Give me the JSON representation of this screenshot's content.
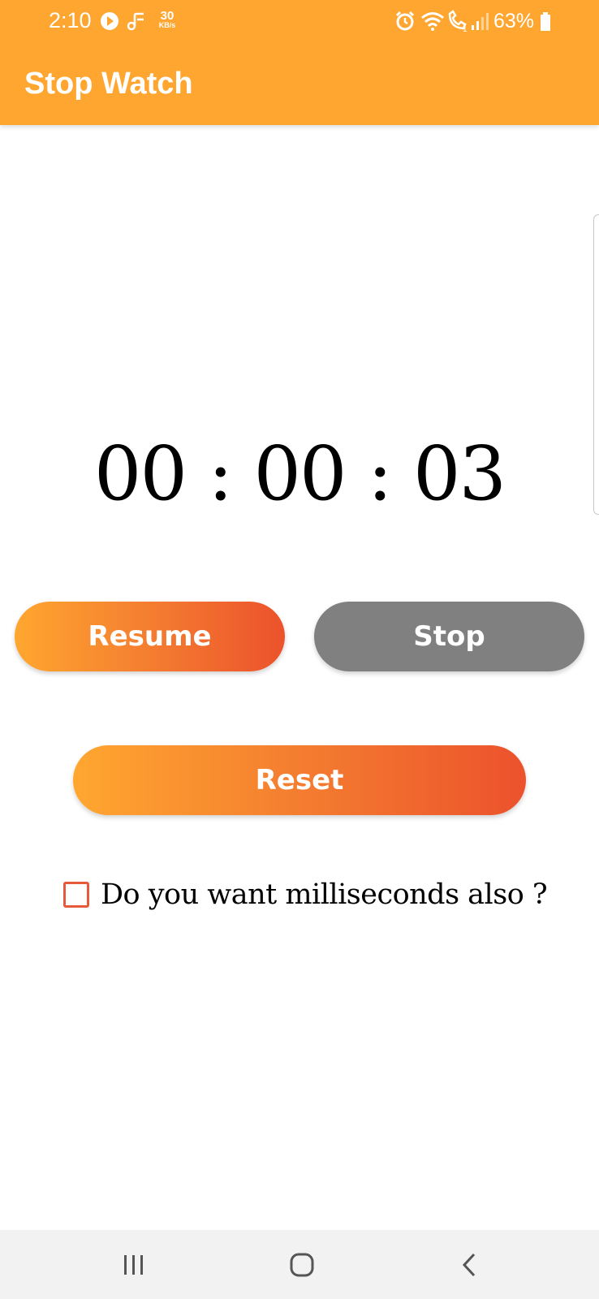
{
  "status_bar": {
    "time": "2:10",
    "net_speed_value": "30",
    "net_speed_unit": "KB/s",
    "battery": "63%",
    "icons": [
      "play-circle-icon",
      "music-share-icon",
      "alarm-icon",
      "wifi-icon",
      "wifi-calling-icon",
      "signal-icon",
      "battery-icon"
    ]
  },
  "app_bar": {
    "title": "Stop Watch"
  },
  "timer": {
    "display": "00 : 00 : 03"
  },
  "buttons": {
    "resume": "Resume",
    "stop": "Stop",
    "reset": "Reset"
  },
  "milliseconds_option": {
    "label": "Do you want milliseconds also ?",
    "checked": false
  },
  "colors": {
    "primary": "#FFA630",
    "gradient_end": "#EC522C",
    "stop_button": "#808080",
    "checkbox_border": "#E65A3A"
  },
  "nav_bar": {
    "icons": [
      "recent-apps-icon",
      "home-icon",
      "back-icon"
    ]
  }
}
